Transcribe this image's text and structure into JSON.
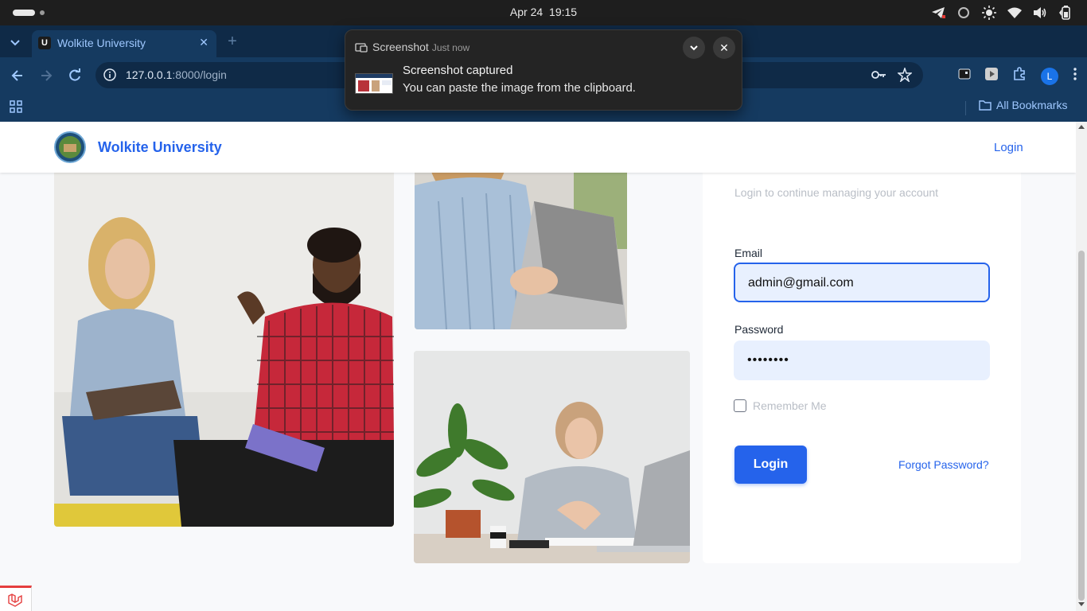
{
  "os": {
    "date": "Apr 24",
    "time": "19:15",
    "tray_icons": [
      "telegram-icon",
      "circle-icon",
      "brightness-icon",
      "wifi-icon",
      "volume-icon",
      "battery-icon"
    ]
  },
  "browser": {
    "tab_title": "Wolkite University",
    "tab_favicon": "U",
    "url_host": "127.0.0.1",
    "url_rest": ":8000/login",
    "profile_initial": "L",
    "bookmarks_label": "All Bookmarks"
  },
  "notification": {
    "app": "Screenshot",
    "time": "Just now",
    "title": "Screenshot captured",
    "body": "You can paste the image from the clipboard."
  },
  "site": {
    "brand": "Wolkite University",
    "nav_login": "Login"
  },
  "login_form": {
    "subtitle": "Login to continue managing your account",
    "email_label": "Email",
    "email_value": "admin@gmail.com",
    "password_label": "Password",
    "password_value": "••••••••",
    "remember_label": "Remember Me",
    "remember_checked": false,
    "submit_label": "Login",
    "forgot_label": "Forgot Password?"
  },
  "colors": {
    "accent": "#2563eb",
    "input_bg": "#e8f0fe",
    "browser_chrome": "#153a60"
  }
}
